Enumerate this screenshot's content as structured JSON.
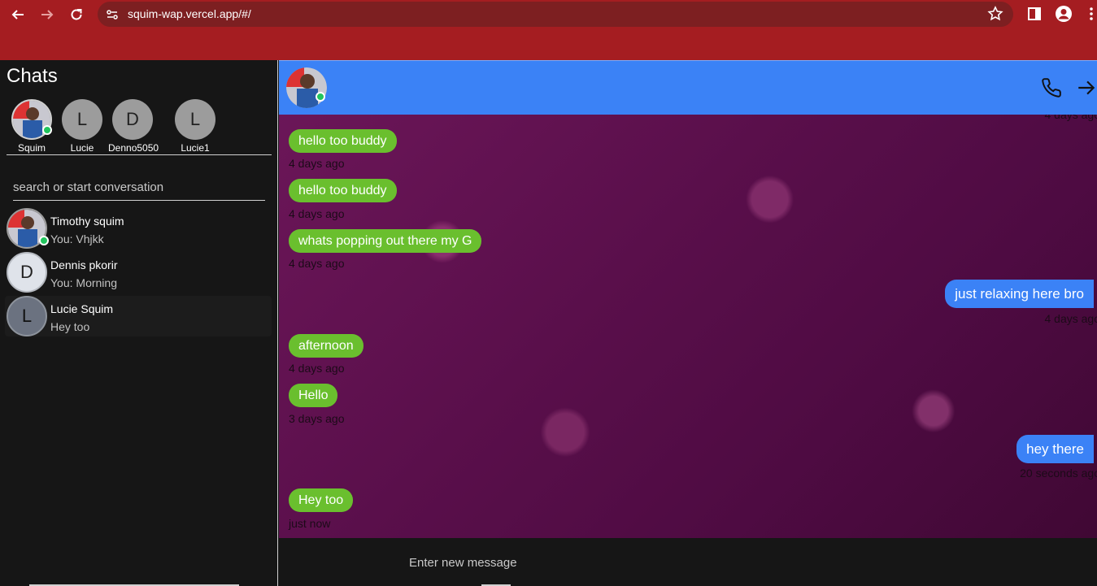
{
  "browser": {
    "url": "squim-wap.vercel.app/#/"
  },
  "sidebar": {
    "title": "Chats",
    "stories": [
      {
        "name": "Squim",
        "initial": "",
        "online": true
      },
      {
        "name": "Lucie",
        "initial": "L",
        "online": false
      },
      {
        "name": "Denno5050",
        "initial": "D",
        "online": false
      },
      {
        "name": "Lucie1",
        "initial": "L",
        "online": false
      }
    ],
    "search_placeholder": "search or start conversation",
    "chats": [
      {
        "name": "Timothy squim",
        "last": "You: Vhjkk",
        "initial": "",
        "online": true
      },
      {
        "name": "Dennis pkorir",
        "last": "You: Morning",
        "initial": "D",
        "online": false
      },
      {
        "name": "Lucie Squim",
        "last": "Hey too",
        "initial": "L",
        "online": false
      }
    ]
  },
  "chat": {
    "top_time": "4 days ago",
    "messages": [
      {
        "text": "hello too buddy",
        "time": "4 days ago",
        "dir": "in"
      },
      {
        "text": "hello too buddy",
        "time": "4 days ago",
        "dir": "in"
      },
      {
        "text": "whats popping out there my G",
        "time": "4 days ago",
        "dir": "in"
      },
      {
        "text": "just relaxing here bro",
        "time": "4 days ago",
        "dir": "out"
      },
      {
        "text": "afternoon",
        "time": "4 days ago",
        "dir": "in"
      },
      {
        "text": "Hello",
        "time": "3 days ago",
        "dir": "in"
      },
      {
        "text": "hey there",
        "time": "20 seconds ago",
        "dir": "out"
      },
      {
        "text": "Hey too",
        "time": "just now",
        "dir": "in"
      }
    ],
    "composer_placeholder": "Enter new message"
  },
  "colors": {
    "browser_bar": "#a51d21",
    "chat_header": "#3b82f6",
    "incoming_bubble": "#6abf2e",
    "outgoing_bubble": "#3b82f6",
    "online": "#22c55e"
  }
}
